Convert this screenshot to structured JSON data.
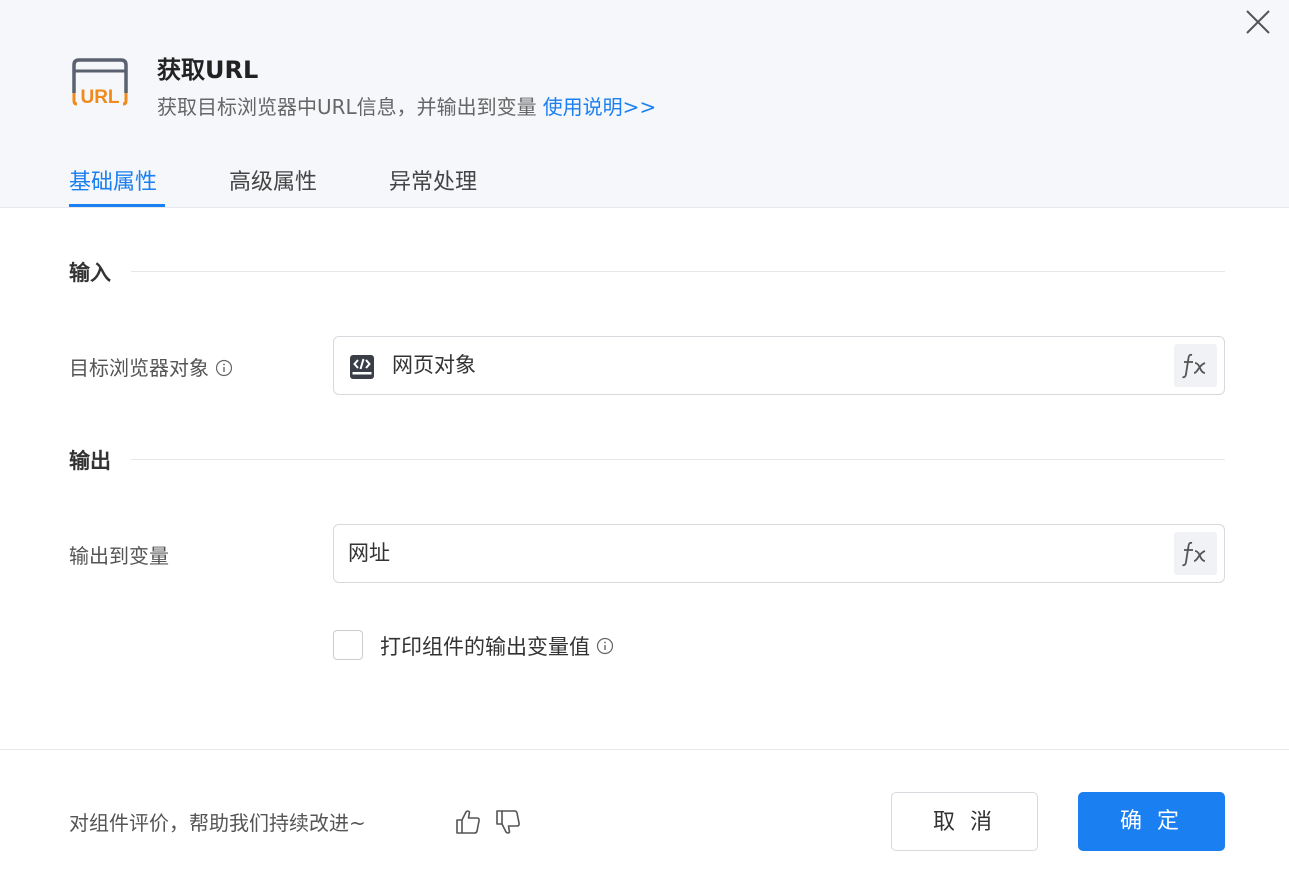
{
  "header": {
    "icon_text": "URL",
    "title": "获取URL",
    "subtitle": "获取目标浏览器中URL信息，并输出到变量",
    "help_link": "使用说明>>"
  },
  "tabs": [
    {
      "label": "基础属性",
      "active": true
    },
    {
      "label": "高级属性",
      "active": false
    },
    {
      "label": "异常处理",
      "active": false
    }
  ],
  "input_section": {
    "title": "输入",
    "fields": [
      {
        "label": "目标浏览器对象",
        "value": "网页对象",
        "icon": "web-object-icon",
        "has_info": true
      }
    ]
  },
  "output_section": {
    "title": "输出",
    "fields": [
      {
        "label": "输出到变量",
        "value": "网址",
        "has_info": false
      }
    ],
    "print_checkbox": {
      "label": "打印组件的输出变量值",
      "checked": false
    }
  },
  "footer": {
    "feedback_text": "对组件评价，帮助我们持续改进~",
    "cancel_label": "取 消",
    "ok_label": "确 定"
  },
  "colors": {
    "accent": "#1a7ff0",
    "icon_orange": "#f08a1c",
    "header_bg": "#f5f7fa"
  }
}
